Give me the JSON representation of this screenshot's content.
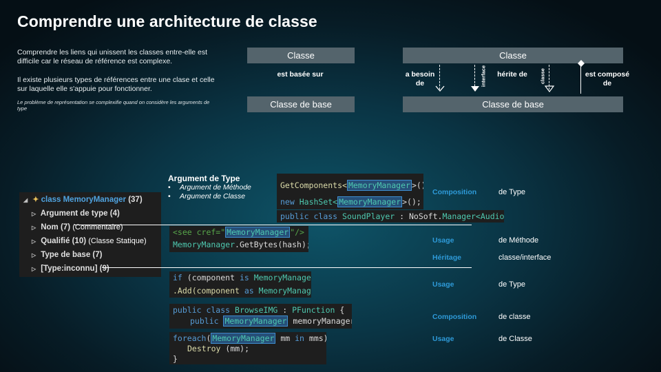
{
  "title": "Comprendre une architecture de classe",
  "intro": {
    "p1": "Comprendre les liens qui unissent les classes entre-elle est difficile car le réseau de référence est complexe.",
    "p2": "Il existe plusieurs types de références entre une clase et celle sur laquelle elle s'appuie pour fonctionner.",
    "p3": "Le problème de représentation se complexifie quand on considère les arguments de type"
  },
  "diagram_left": {
    "top_box": "Classe",
    "relation": "est basée sur",
    "bottom_box": "Classe de base"
  },
  "diagram_right": {
    "top_box": "Classe",
    "bottom_box": "Classe de base",
    "relations": {
      "a_besoin": "a besoin de",
      "interface": "interface",
      "herite": "hérite de",
      "classe": "classe",
      "compose": "est composé de"
    }
  },
  "tree": {
    "root": {
      "label": "class MemoryManager",
      "count": "(37)"
    },
    "items": [
      {
        "label": "Argument de type",
        "count": "(4)",
        "note": ""
      },
      {
        "label": "Nom",
        "count": "(7)",
        "note": "(Commentaire)"
      },
      {
        "label": "Qualifié",
        "count": "(10)",
        "note": "(Classe Statique)"
      },
      {
        "label": "Type de base",
        "count": "(7)",
        "note": ""
      },
      {
        "label": "[Type:inconnu]",
        "count": "(9)",
        "note": ""
      }
    ]
  },
  "argument_de_type": {
    "title": "Argument de Type",
    "items": [
      "Argument de Méthode",
      "Argument de Classe"
    ]
  },
  "code": {
    "s1": {
      "l1_pre": "GetComponents<",
      "l1_hl": "MemoryManager",
      "l1_post": ">();",
      "l2_kw": "new",
      "l2_ty": "HashSet<",
      "l2_hl": "MemoryManager",
      "l2_post": ">();"
    },
    "s2": {
      "kw1": "public",
      "kw2": "class",
      "name": "SoundPlayer",
      "sep": " : NoSoft.",
      "base": "Manager<AudioSource>",
      "brace": " {"
    },
    "s3": {
      "c1": "<see cref=\"",
      "hl": "MemoryManager",
      "c2": "\"/>",
      "l2_ty": "MemoryManager",
      "l2_post": ".GetBytes(hash);"
    },
    "s4": {
      "l1_kw": "if",
      "l1_a": " (component ",
      "l1_kw2": "is",
      "l1_ty": " MemoryManager",
      "l1_b": ")",
      "l2_a": ".Add(component ",
      "l2_kw": "as",
      "l2_ty": " MemoryManager",
      "l2_b": ");"
    },
    "s5": {
      "l1_kw": "public class ",
      "l1_name": "BrowseIMG",
      "l1_sep": " : ",
      "l1_base": "PFunction",
      "l1_brace": " {",
      "l2_kw": "public ",
      "l2_hl": "MemoryManager",
      "l2_post": " memoryManager;"
    },
    "s6": {
      "l1_kw": "foreach",
      "l1_a": "(",
      "l1_hl": "MemoryManager",
      "l1_b": " mm ",
      "l1_kw2": "in",
      "l1_c": " mms) {",
      "l2_fn": "Destroy",
      "l2_post": " (mm);",
      "l3": "}"
    }
  },
  "rows": [
    {
      "kind": "Composition",
      "target": "de Type"
    },
    {
      "kind": "Usage",
      "target": "de Méthode"
    },
    {
      "kind": "Héritage",
      "target": "classe/interface"
    },
    {
      "kind": "Usage",
      "target": "de Type"
    },
    {
      "kind": "Composition",
      "target": "de classe"
    },
    {
      "kind": "Usage",
      "target": "de Classe"
    }
  ],
  "colors": {
    "accent": "#2e9ad8",
    "box": "#54646c",
    "code_bg": "#1e1e1e"
  }
}
